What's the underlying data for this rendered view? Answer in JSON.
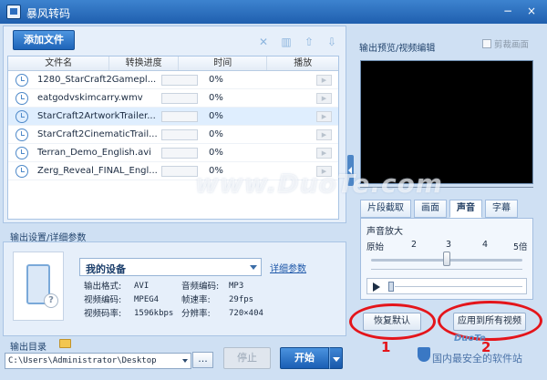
{
  "window": {
    "title": "暴风转码",
    "min": "−",
    "close": "×"
  },
  "toolbar": {
    "add_label": "添加文件",
    "icons": [
      "close-icon",
      "trash-icon",
      "arrow-up-icon",
      "arrow-down-icon"
    ]
  },
  "file_table": {
    "columns": [
      "文件名",
      "转换进度",
      "时间",
      "播放"
    ],
    "rows": [
      {
        "name": "1280_StarCraft2Gamepl...",
        "progress": "0%",
        "selected": false
      },
      {
        "name": "eatgodvskimcarry.wmv",
        "progress": "0%",
        "selected": false
      },
      {
        "name": "StarCraft2ArtworkTrailer...",
        "progress": "0%",
        "selected": true
      },
      {
        "name": "StarCraft2CinematicTrail...",
        "progress": "0%",
        "selected": false
      },
      {
        "name": "Terran_Demo_English.avi",
        "progress": "0%",
        "selected": false
      },
      {
        "name": "Zerg_Reveal_FINAL_Engl...",
        "progress": "0%",
        "selected": false
      }
    ]
  },
  "output_settings": {
    "header": "输出设置/详细参数",
    "device": "我的设备",
    "detail_link": "详细参数",
    "params": [
      {
        "k1": "输出格式:",
        "v1": "AVI",
        "k2": "音频编码:",
        "v2": "MP3"
      },
      {
        "k1": "视频编码:",
        "v1": "MPEG4",
        "k2": "帧速率:",
        "v2": "29fps"
      },
      {
        "k1": "视频码率:",
        "v1": "1596kbps",
        "k2": "分辨率:",
        "v2": "720×404"
      }
    ]
  },
  "output_dir": {
    "label": "输出目录",
    "path": "C:\\Users\\Administrator\\Desktop",
    "browse": "..."
  },
  "actions": {
    "stop": "停止",
    "start": "开始"
  },
  "preview": {
    "title": "输出预览/视频编辑",
    "crop_label": "剪裁画面",
    "tabs": [
      "片段截取",
      "画面",
      "声音",
      "字幕"
    ],
    "active_tab": "声音"
  },
  "audio": {
    "label": "声音放大",
    "scale": [
      "原始",
      "2",
      "3",
      "4",
      "5倍"
    ],
    "amplify_level": 3,
    "restore_label": "恢复默认",
    "apply_all_label": "应用到所有视频"
  },
  "annotations": {
    "num1": "1",
    "num2": "2",
    "color": "#e4151b"
  },
  "watermark": {
    "text": "www.DuoTe.com",
    "logo": "DuoTe",
    "site": "国内最安全的软件站"
  },
  "colors": {
    "accent": "#1f5fae",
    "panel": "#e6effa"
  }
}
